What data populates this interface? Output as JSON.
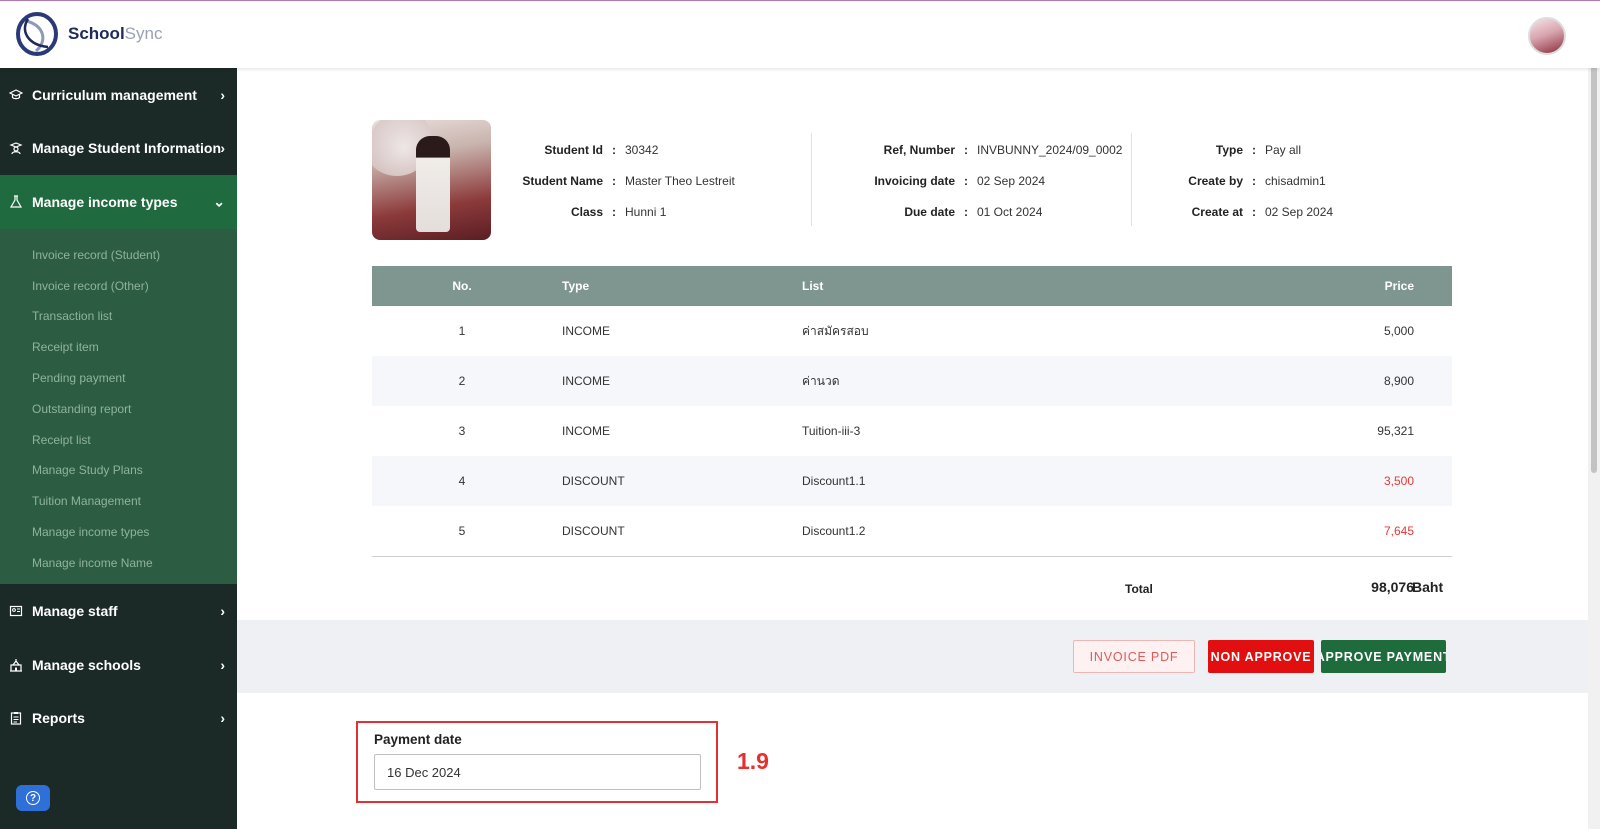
{
  "app": {
    "logo_bold": "School",
    "logo_light": "Sync"
  },
  "sidebar": {
    "items_top": [
      {
        "label": "Curriculum management",
        "icon": "graduation-cap-icon"
      },
      {
        "label": "Manage Student Information",
        "icon": "student-icon"
      },
      {
        "label": "Manage income types",
        "icon": "flask-icon"
      }
    ],
    "submenu": [
      "Invoice record (Student)",
      "Invoice record (Other)",
      "Transaction list",
      "Receipt item",
      "Pending payment",
      "Outstanding report",
      "Receipt list",
      "Manage Study Plans",
      "Tuition Management",
      "Manage income types",
      "Manage income Name"
    ],
    "items_bottom": [
      {
        "label": "Manage staff",
        "icon": "staff-icon"
      },
      {
        "label": "Manage schools",
        "icon": "school-icon"
      },
      {
        "label": "Reports",
        "icon": "clipboard-icon"
      }
    ],
    "help": "?"
  },
  "invoice": {
    "student_id_label": "Student Id",
    "student_id": "30342",
    "student_name_label": "Student Name",
    "student_name": "Master Theo Lestreit",
    "class_label": "Class",
    "class": "Hunni 1",
    "ref_label": "Ref, Number",
    "ref": "INVBUNNY_2024/09_0002",
    "invoicing_date_label": "Invoicing date",
    "invoicing_date": "02 Sep 2024",
    "due_date_label": "Due date",
    "due_date": "01 Oct 2024",
    "type_label": "Type",
    "type": "Pay all",
    "create_by_label": "Create by",
    "create_by": "chisadmin1",
    "create_at_label": "Create at",
    "create_at": "02 Sep 2024",
    "colon": ":"
  },
  "table": {
    "headers": {
      "no": "No.",
      "type": "Type",
      "list": "List",
      "price": "Price"
    },
    "rows": [
      {
        "no": "1",
        "type": "INCOME",
        "list": "ค่าสมัครสอบ",
        "price": "5,000"
      },
      {
        "no": "2",
        "type": "INCOME",
        "list": "ค่านวด",
        "price": "8,900"
      },
      {
        "no": "3",
        "type": "INCOME",
        "list": "Tuition-iii-3",
        "price": "95,321"
      },
      {
        "no": "4",
        "type": "DISCOUNT",
        "list": "Discount1.1",
        "price": "3,500"
      },
      {
        "no": "5",
        "type": "DISCOUNT",
        "list": "Discount1.2",
        "price": "7,645"
      }
    ],
    "total_label": "Total",
    "total_value": "98,076",
    "currency": "Baht"
  },
  "actions": {
    "invoice_pdf": "INVOICE PDF",
    "non_approve": "NON APPROVE",
    "approve_payment": "APPROVE PAYMENT"
  },
  "payment": {
    "label": "Payment date",
    "value": "16 Dec 2024",
    "annotation": "1.9"
  },
  "colors": {
    "sidebar_bg": "#1c2a27",
    "active_bg": "#1f6b3f",
    "submenu_bg": "#2c5d42",
    "table_header": "#7f9690",
    "danger": "#e10f0f",
    "approve": "#1e6b3c"
  }
}
